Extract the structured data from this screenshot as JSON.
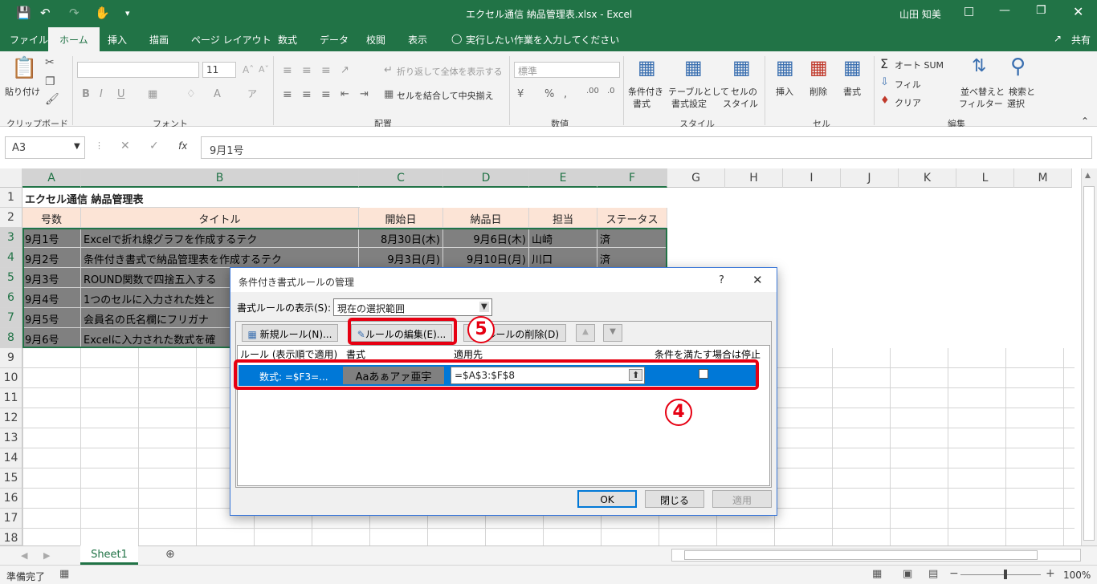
{
  "window": {
    "title": "エクセル通信 納品管理表.xlsx - Excel",
    "user": "山田 知美",
    "share": "共有"
  },
  "tabs": [
    "ファイル",
    "ホーム",
    "挿入",
    "描画",
    "ページ レイアウト",
    "数式",
    "データ",
    "校閲",
    "表示"
  ],
  "tell_me": "実行したい作業を入力してください",
  "ribbon": {
    "paste": "貼り付け",
    "clipboard": "クリップボード",
    "font_group": "フォント",
    "font_size": "11",
    "wrap": "折り返して全体を表示する",
    "merge": "セルを結合して中央揃え",
    "align_group": "配置",
    "number_format": "標準",
    "number_group": "数値",
    "cond_format": "条件付き",
    "cond_format2": "書式",
    "table_format": "テーブルとして",
    "table_format2": "書式設定",
    "cell_style": "セルの",
    "cell_style2": "スタイル",
    "style_group": "スタイル",
    "insert": "挿入",
    "delete": "削除",
    "format": "書式",
    "cells_group": "セル",
    "autosum": "オート SUM",
    "fill": "フィル",
    "clear": "クリア",
    "sort": "並べ替えと",
    "sort2": "フィルター",
    "find": "検索と",
    "find2": "選択",
    "edit_group": "編集"
  },
  "namebox": "A3",
  "formula": "9月1号",
  "columns": [
    "A",
    "B",
    "C",
    "D",
    "E",
    "F",
    "G",
    "H",
    "I",
    "J",
    "K",
    "L",
    "M"
  ],
  "rows": [
    "1",
    "2",
    "3",
    "4",
    "5",
    "6",
    "7",
    "8",
    "9",
    "10",
    "11",
    "12",
    "13",
    "14",
    "15",
    "16",
    "17",
    "18"
  ],
  "sheet": {
    "title": "エクセル通信 納品管理表",
    "headers": [
      "号数",
      "タイトル",
      "開始日",
      "納品日",
      "担当",
      "ステータス"
    ],
    "data": [
      [
        "9月1号",
        "Excelで折れ線グラフを作成するテク",
        "8月30日(木)",
        "9月6日(木)",
        "山崎",
        "済"
      ],
      [
        "9月2号",
        "条件付き書式で納品管理表を作成するテク",
        "9月3日(月)",
        "9月10日(月)",
        "川口",
        "済"
      ],
      [
        "9月3号",
        "ROUND関数で四捨五入する",
        "",
        "",
        "",
        ""
      ],
      [
        "9月4号",
        "1つのセルに入力された姓と",
        "",
        "",
        "",
        ""
      ],
      [
        "9月5号",
        "会員名の氏名欄にフリガナ",
        "",
        "",
        "",
        ""
      ],
      [
        "9月6号",
        "Excelに入力された数式を確",
        "",
        "",
        "",
        ""
      ]
    ]
  },
  "sheet_tab": "Sheet1",
  "status": "準備完了",
  "zoom": "100%",
  "dialog": {
    "title": "条件付き書式ルールの管理",
    "help": "?",
    "show_label": "書式ルールの表示(S):",
    "show_value": "現在の選択範囲",
    "new_rule": "新規ルール(N)...",
    "edit_rule": "ルールの編集(E)...",
    "delete_rule": "ルールの削除(D)",
    "col_rule": "ルール (表示順で適用)",
    "col_format": "書式",
    "col_applies": "適用先",
    "col_stop": "条件を満たす場合は停止",
    "rule_text": "数式: =$F3=...",
    "preview": "Aaあぁアァ亜宇",
    "applies_value": "=$A$3:$F$8",
    "ok": "OK",
    "close": "閉じる",
    "apply": "適用"
  },
  "annotations": {
    "four": "4",
    "five": "5"
  }
}
